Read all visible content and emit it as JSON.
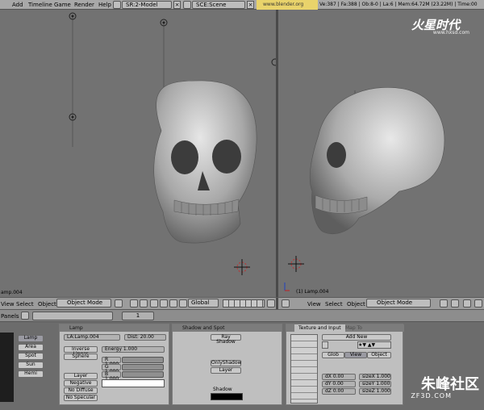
{
  "topbar": {
    "menus": [
      "Add",
      "Timeline",
      "Game",
      "Render",
      "Help"
    ],
    "screen_select": "SR:2-Model",
    "scene_select": "SCE:Scene",
    "url": "www.blender.org 248.1",
    "stats": "Ve:387 | Fa:388 | Ob:8-0 | La:6 | Mem:64.72M (23.22M) | Time:00"
  },
  "watermark_top": {
    "brand": "火星时代",
    "site": "www.hxsd.com"
  },
  "viewport_left": {
    "label": "amp.004"
  },
  "viewport_right": {
    "label": "(1) Lamp.004"
  },
  "header_left": {
    "menus": [
      "View",
      "Select",
      "Object"
    ],
    "mode": "Object Mode",
    "orientation": "Global"
  },
  "header_right": {
    "menus": [
      "View",
      "Select",
      "Object"
    ],
    "mode": "Object Mode"
  },
  "panels_row": {
    "label": "Panels",
    "frame": "1"
  },
  "lamp_types": [
    "Lamp",
    "Area",
    "Spot",
    "Sun",
    "Hemi"
  ],
  "lamp_panel": {
    "title": "Lamp",
    "lamp_name": "LA:Lamp.004",
    "dist": "Dist: 20.00",
    "falloff": "Inverse Linear",
    "sphere": "Sphere",
    "energy": "Energy 1.000",
    "r": "R 1.000",
    "g": "G 1.000",
    "b": "B 1.000",
    "layer": "Layer",
    "negative": "Negative",
    "no_diffuse": "No Diffuse",
    "no_specular": "No Specular"
  },
  "shadow_panel": {
    "title": "Shadow and Spot",
    "ray_shadow": "Ray Shadow",
    "only_shadow": "OnlyShadow",
    "layer": "Layer",
    "shadow_label": "Shadow"
  },
  "texture_panel": {
    "tab_texture": "Texture and Input",
    "tab_mapto": "Map To",
    "add_new": "Add New",
    "glob": "Glob",
    "view": "View",
    "object": "Object",
    "dx": "dX 0.00",
    "dy": "dY 0.00",
    "dz": "dZ 0.00",
    "sizex": "sizeX 1.000",
    "sizey": "sizeY 1.000",
    "sizez": "sizeZ 1.000"
  },
  "watermark_bottom": {
    "brand": "朱峰社区",
    "site": "ZF3D.COM"
  }
}
